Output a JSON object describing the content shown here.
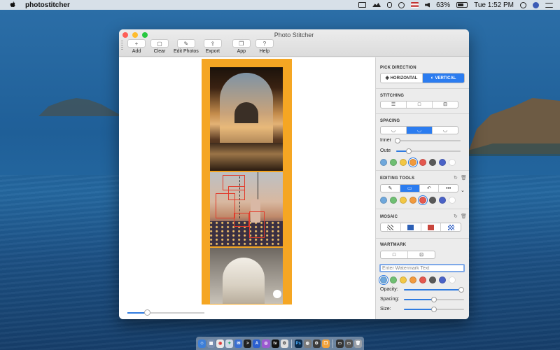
{
  "menubar": {
    "app_name": "photostitcher",
    "battery": "63%",
    "clock": "Tue 1:52 PM"
  },
  "window": {
    "title": "Photo Stitcher",
    "toolbar": [
      {
        "label": "Add",
        "icon": "plus-icon"
      },
      {
        "label": "Clear",
        "icon": "trash-icon"
      },
      {
        "label": "Edit Photos",
        "icon": "edit-icon"
      },
      {
        "label": "Export",
        "icon": "export-icon"
      },
      {
        "label": "App",
        "icon": "box-icon"
      },
      {
        "label": "Help",
        "icon": "question-icon"
      }
    ]
  },
  "canvas": {
    "strip_color": "#f5a623",
    "zoom_level": 0.25
  },
  "panel": {
    "pick_direction": {
      "title": "PICK DIRECTION",
      "options": [
        "HORIZONTAL",
        "VERTICAL"
      ],
      "selected": "VERTICAL"
    },
    "stitching": {
      "title": "STITCHING"
    },
    "spacing": {
      "title": "SPACING",
      "inner_label": "Inner",
      "outer_label": "Oute",
      "inner_value": 0.0,
      "outer_value": 0.2
    },
    "editing_tools": {
      "title": "EDITING TOOLS"
    },
    "mosaic": {
      "title": "MOSAIC"
    },
    "watermark": {
      "title": "WARTMARK",
      "placeholder": "Enter Watermark Text",
      "opacity_label": "Opacity:",
      "spacing_label": "Spacing:",
      "size_label": "Size:",
      "opacity_value": 1.0,
      "spacing_value": 0.5,
      "size_value": 0.5
    },
    "palette": [
      "#6fa8dc",
      "#6fbf73",
      "#f3c744",
      "#f29a3c",
      "#e4584f",
      "#595959",
      "#4a62c7",
      "#ffffff"
    ],
    "accent": "#2b7cf0"
  }
}
